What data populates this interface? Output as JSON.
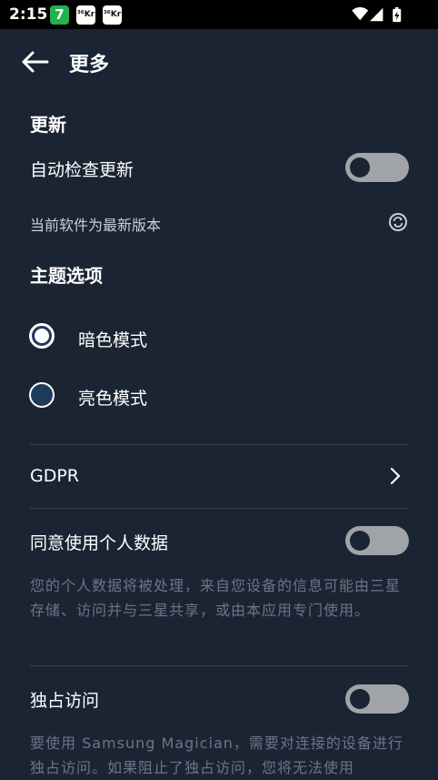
{
  "status": {
    "time": "2:15",
    "apps": [
      "7",
      "³⁶Kr",
      "³⁶Kr"
    ]
  },
  "appbar": {
    "title": "更多"
  },
  "update": {
    "section_title": "更新",
    "auto_check_label": "自动检查更新",
    "auto_check_on": false,
    "status_text": "当前软件为最新版本"
  },
  "theme": {
    "section_title": "主题选项",
    "options": [
      {
        "label": "暗色模式",
        "selected": true
      },
      {
        "label": "亮色模式",
        "selected": false
      }
    ]
  },
  "gdpr": {
    "label": "GDPR"
  },
  "personal_data": {
    "label": "同意使用个人数据",
    "on": false,
    "description": "您的个人数据将被处理，来自您设备的信息可能由三星存储、访问并与三星共享，或由本应用专门使用。"
  },
  "exclusive": {
    "label": "独占访问",
    "on": false,
    "description": "要使用 Samsung Magician，需要对连接的设备进行独占访问。如果阻止了独占访问，您将无法使用"
  },
  "colors": {
    "background": "#1b2433",
    "toggle_off": "#a0a3a8",
    "muted_text": "#6b7585"
  }
}
